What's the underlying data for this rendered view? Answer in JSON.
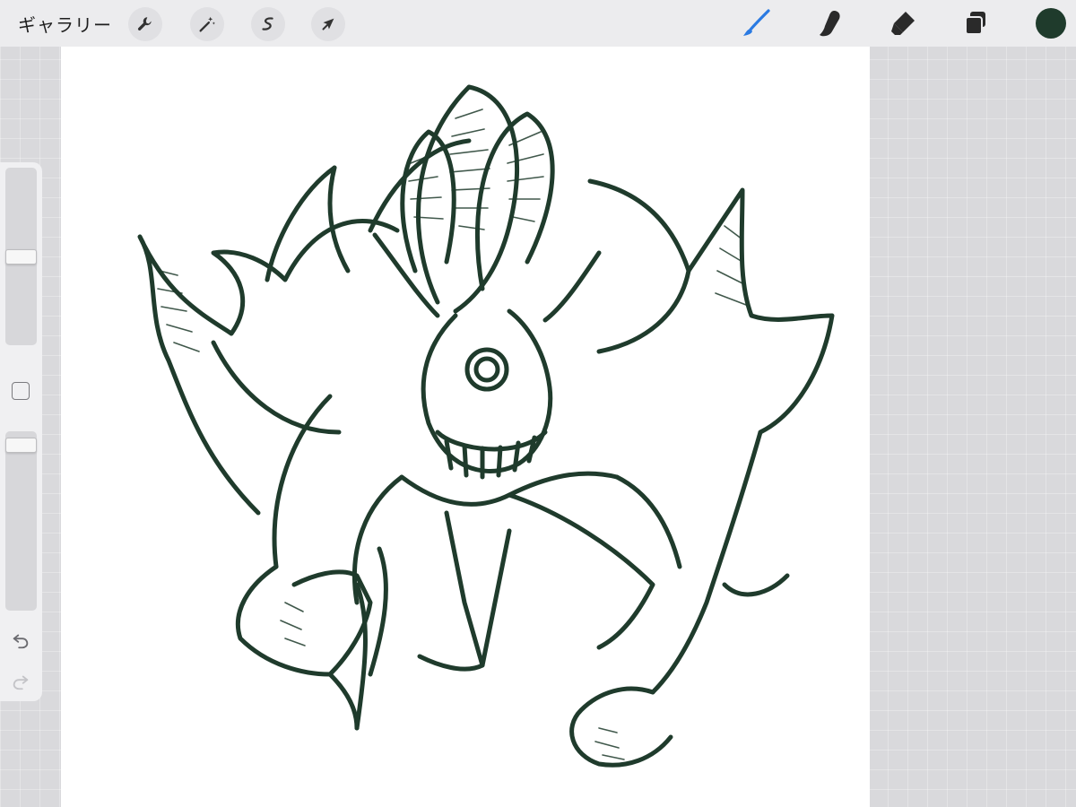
{
  "toolbar": {
    "gallery_label": "ギャラリー",
    "left_tools": [
      {
        "name": "actions",
        "icon": "wrench-icon"
      },
      {
        "name": "adjustments",
        "icon": "magic-wand-icon"
      },
      {
        "name": "selection",
        "icon": "selection-s-icon"
      },
      {
        "name": "transform",
        "icon": "arrow-cursor-icon"
      }
    ],
    "right_tools": [
      {
        "name": "brush",
        "icon": "brush-icon",
        "active": true
      },
      {
        "name": "smudge",
        "icon": "smudge-finger-icon",
        "active": false
      },
      {
        "name": "eraser",
        "icon": "eraser-icon",
        "active": false
      },
      {
        "name": "layers",
        "icon": "layers-icon",
        "active": false
      }
    ],
    "current_color": "#1f3b2c",
    "active_tool_color": "#2a7ae2"
  },
  "canvas": {
    "background": "#ffffff",
    "ink_color": "#1f3b2c",
    "artwork": "line-art-horned-creature-icon"
  },
  "sidebar": {
    "brush_size_level": 0.5,
    "opacity_level": 0.96,
    "modify_button_icon": "square-icon",
    "undo_icon": "undo-icon",
    "redo_icon": "redo-icon",
    "redo_enabled": false
  }
}
